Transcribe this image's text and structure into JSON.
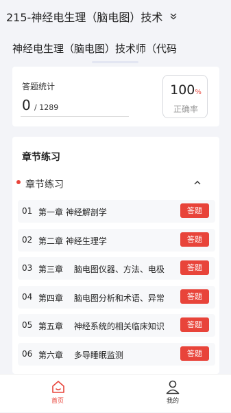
{
  "header": {
    "title": "215-神经电生理（脑电图）技术",
    "subtitle": "神经电生理（脑电图）技术师（代码"
  },
  "stats": {
    "label": "答题统计",
    "answered": "0",
    "total": "/ 1289",
    "accuracy_value": "100",
    "accuracy_unit": "%",
    "accuracy_label": "正确率"
  },
  "chapters": {
    "heading": "章节练习",
    "group_label": "章节练习",
    "items": [
      {
        "num": "01",
        "name": "第一章 神经解剖学",
        "button": "答题"
      },
      {
        "num": "02",
        "name": "第二章 神经生理学",
        "button": "答题"
      },
      {
        "num": "03",
        "name": "第三章　 脑电图仪器、方法、电极",
        "button": "答题"
      },
      {
        "num": "04",
        "name": "第四章　 脑电图分析和术语、异常",
        "button": "答题"
      },
      {
        "num": "05",
        "name": "第五章　 神经系统的相关临床知识",
        "button": "答题"
      },
      {
        "num": "06",
        "name": "第六章　 多导睡眠监测",
        "button": "答题"
      }
    ]
  },
  "tabbar": {
    "home_label": "首页",
    "mine_label": "我的"
  },
  "colors": {
    "accent": "#e8443a",
    "background": "#f3f4f8"
  }
}
